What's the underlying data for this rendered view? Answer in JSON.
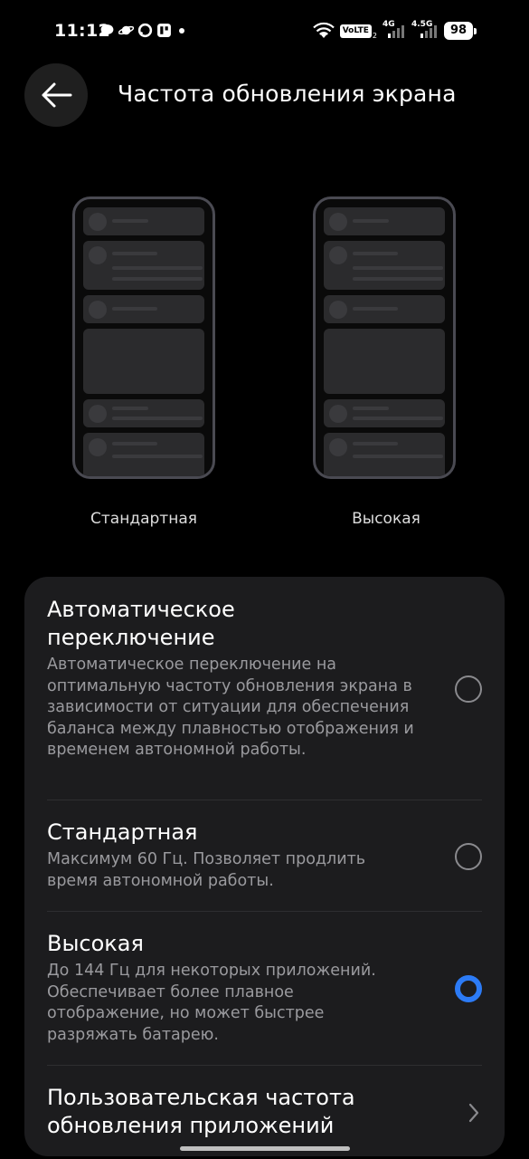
{
  "status_bar": {
    "time": "11:12",
    "volte": "VoLTE",
    "sim1_network": "4G",
    "sim2_network": "4.5G",
    "battery": "98"
  },
  "header": {
    "title": "Частота обновления экрана"
  },
  "previews": {
    "standard_label": "Стандартная",
    "high_label": "Высокая"
  },
  "options": [
    {
      "title": "Автоматическое переключение",
      "description": "Автоматическое переключение на оптимальную частоту обновления экрана в зависимости от ситуации для обеспечения баланса между плавностью отображения и временем автономной работы.",
      "selected": false
    },
    {
      "title": "Стандартная",
      "description": "Максимум 60 Гц. Позволяет продлить время автономной работы.",
      "selected": false
    },
    {
      "title": "Высокая",
      "description": "До 144 Гц для некоторых приложений. Обеспечивает более плавное отображение, но может быстрее разряжать батарею.",
      "selected": true
    }
  ],
  "custom_app_rate": {
    "title": "Пользовательская частота обновления приложений"
  },
  "colors": {
    "accent": "#2c7bf6",
    "card_bg": "#1c1c1e",
    "background": "#000000"
  }
}
